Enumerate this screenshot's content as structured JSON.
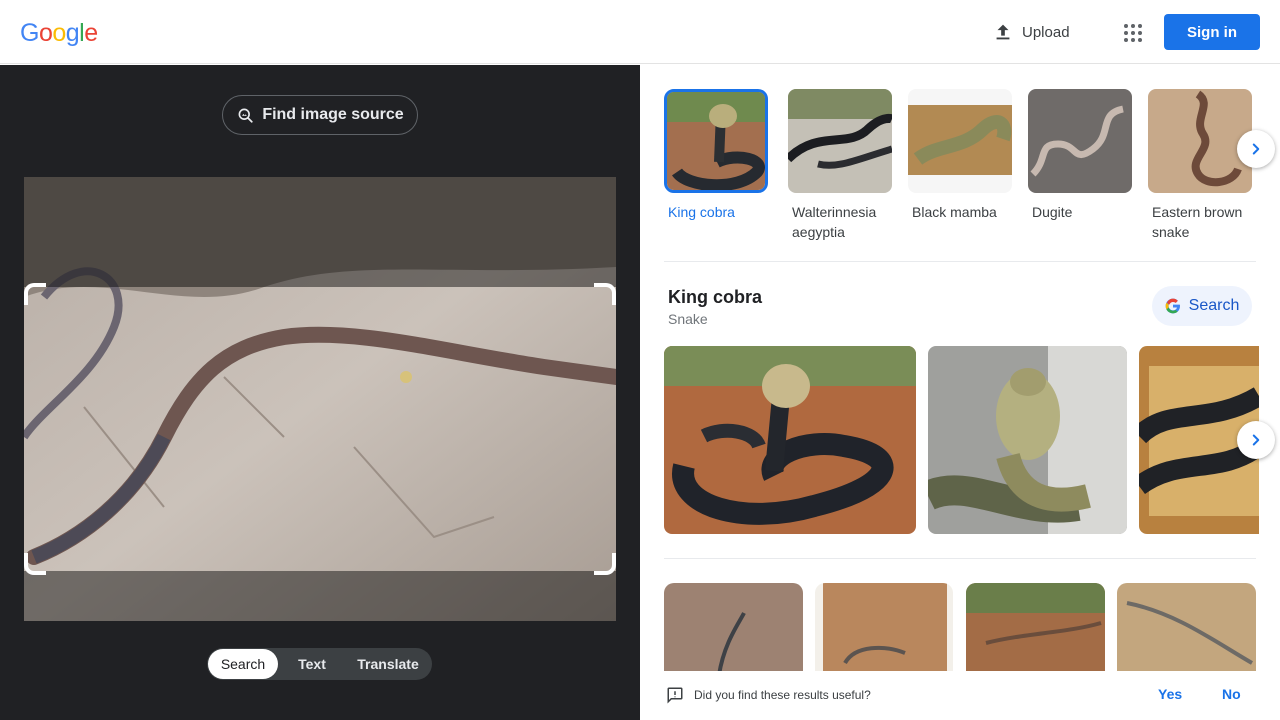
{
  "header": {
    "logo_letters": [
      "G",
      "o",
      "o",
      "g",
      "l",
      "e"
    ],
    "upload_label": "Upload",
    "apps_icon": "apps-grid-icon",
    "signin_label": "Sign in"
  },
  "lens": {
    "find_source_label": "Find image source",
    "modes": [
      {
        "label": "Search",
        "active": true
      },
      {
        "label": "Text",
        "active": false
      },
      {
        "label": "Translate",
        "active": false
      }
    ]
  },
  "entities": [
    {
      "label": "King cobra",
      "selected": true
    },
    {
      "label": "Walterinnesia aegyptia",
      "selected": false
    },
    {
      "label": "Black mamba",
      "selected": false
    },
    {
      "label": "Dugite",
      "selected": false
    },
    {
      "label": "Eastern brown snake",
      "selected": false
    }
  ],
  "knowledge": {
    "title": "King cobra",
    "subtitle": "Snake",
    "search_label": "Search"
  },
  "feedback": {
    "question": "Did you find these results useful?",
    "yes": "Yes",
    "no": "No"
  },
  "colors": {
    "accent": "#1a73e8",
    "dark_pane": "#202124"
  }
}
